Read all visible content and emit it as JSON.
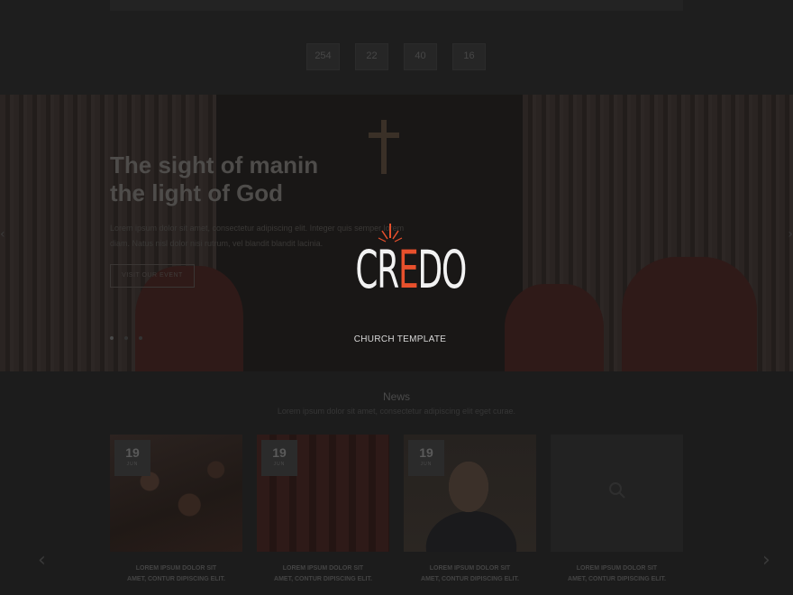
{
  "countdown": {
    "items": [
      {
        "value": "254"
      },
      {
        "value": "22"
      },
      {
        "value": "40"
      },
      {
        "value": "16"
      }
    ]
  },
  "hero": {
    "title": "The sight of manin the light of God",
    "title_line1": "The sight of manin",
    "title_line2": "the light of God",
    "text": "Lorem ipsum dolor sit amet, consectetur adipiscing elit. Integer quis semper lorem diam. Natus nisl dolor nisi rutrum, vel blandit blandit lacinia.",
    "button_label": "VISIT OUR EVENT"
  },
  "logo": {
    "word_part1": "CR",
    "word_accent": "E",
    "word_part2": "DO",
    "subtitle": "CHURCH TEMPLATE"
  },
  "news": {
    "title": "News",
    "subtitle": "Lorem ipsum dolor sit amet, consectetur adipiscing elit eget curae."
  },
  "cards": [
    {
      "day": "19",
      "month": "JUN",
      "caption_line1": "LOREM IPSUM DOLOR SIT",
      "caption_line2": "AMET, CONTUR DIPISCING ELIT."
    },
    {
      "day": "19",
      "month": "JUN",
      "caption_line1": "LOREM IPSUM DOLOR SIT",
      "caption_line2": "AMET, CONTUR DIPISCING ELIT."
    },
    {
      "day": "19",
      "month": "JUN",
      "caption_line1": "LOREM IPSUM DOLOR SIT",
      "caption_line2": "AMET, CONTUR DIPISCING ELIT."
    },
    {
      "caption_line1": "LOREM IPSUM DOLOR SIT",
      "caption_line2": "AMET, CONTUR DIPISCING ELIT."
    }
  ],
  "colors": {
    "accent": "#e8502c",
    "overlay": "#141414",
    "logo_text": "#f2f2f2"
  },
  "icons": {
    "hero_prev": "chevron-left-icon",
    "hero_next": "chevron-right-icon",
    "news_prev": "chevron-left-icon",
    "news_next": "chevron-right-icon",
    "card_search": "search-icon"
  }
}
